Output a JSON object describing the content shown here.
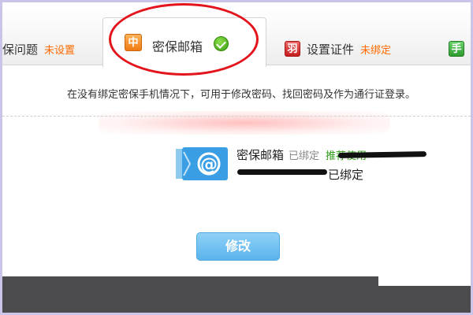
{
  "tabs": {
    "question": {
      "label": "保问题",
      "status": "未设置"
    },
    "email": {
      "icon": "中",
      "label": "密保邮箱",
      "status_icon": "check-icon"
    },
    "certificate": {
      "icon": "羽",
      "label": "设置证件",
      "status": "未绑定"
    },
    "next": {
      "icon": "手"
    }
  },
  "description": "在没有绑定密保手机情况下，可用于修改密码、找回密码及作为通行证登录。",
  "email_section": {
    "title": "密保邮箱",
    "status": "已绑定",
    "recommend_link": "推荐使用",
    "bound_text": "已绑定"
  },
  "modify_button": "修改",
  "colors": {
    "status_orange": "#ff6a00",
    "link_green": "#2d9c14",
    "button_blue": "#5ab4ee",
    "highlight_red": "#e3141c"
  }
}
